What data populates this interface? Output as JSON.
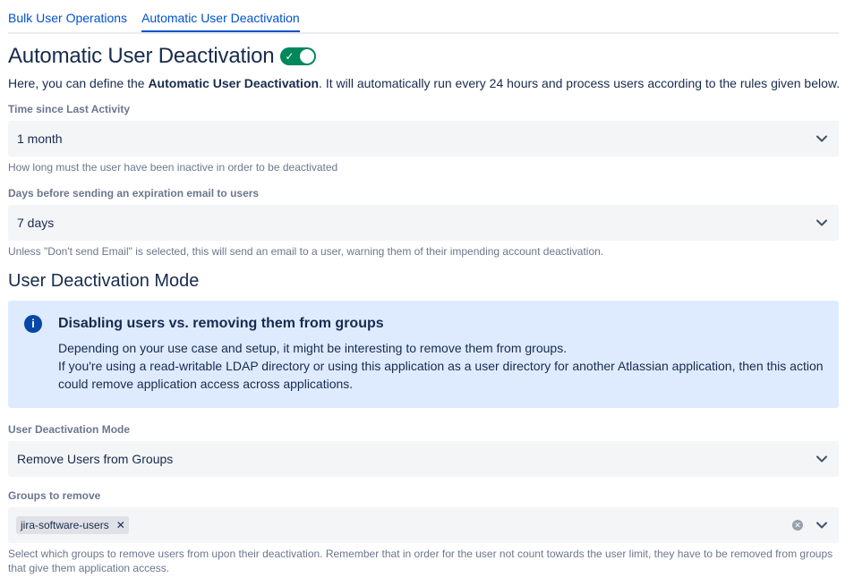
{
  "tabs": [
    {
      "label": "Bulk User Operations"
    },
    {
      "label": "Automatic User Deactivation"
    }
  ],
  "page": {
    "title": "Automatic User Deactivation",
    "toggle_enabled": true,
    "intro_prefix": "Here, you can define the ",
    "intro_bold": "Automatic User Deactivation",
    "intro_suffix": ". It will automatically run every 24 hours and process users according to the rules given below."
  },
  "fields": {
    "inactivity": {
      "label": "Time since Last Activity",
      "value": "1 month",
      "helper": "How long must the user have been inactive in order to be deactivated"
    },
    "expiration_email": {
      "label": "Days before sending an expiration email to users",
      "value": "7 days",
      "helper": "Unless \"Don't send Email\" is selected, this will send an email to a user, warning them of their impending account deactivation."
    },
    "mode": {
      "label": "User Deactivation Mode",
      "value": "Remove Users from Groups"
    },
    "groups": {
      "label": "Groups to remove",
      "tags": [
        "jira-software-users"
      ],
      "helper": "Select which groups to remove users from upon their deactivation. Remember that in order for the user not count towards the user limit, they have to be removed from groups that give them application access."
    }
  },
  "mode_section": {
    "title": "User Deactivation Mode"
  },
  "info_panel": {
    "icon": "info-icon",
    "title": "Disabling users vs. removing them from groups",
    "line1": "Depending on your use case and setup, it might be interesting to remove them from groups.",
    "line2": "If you're using a read-writable LDAP directory or using this application as a user directory for another Atlassian application, then this action could remove application access across applications."
  },
  "colors": {
    "link": "#0052cc",
    "toggle_on": "#00875a",
    "panel_bg": "#deebff",
    "field_bg": "#f4f5f7"
  }
}
